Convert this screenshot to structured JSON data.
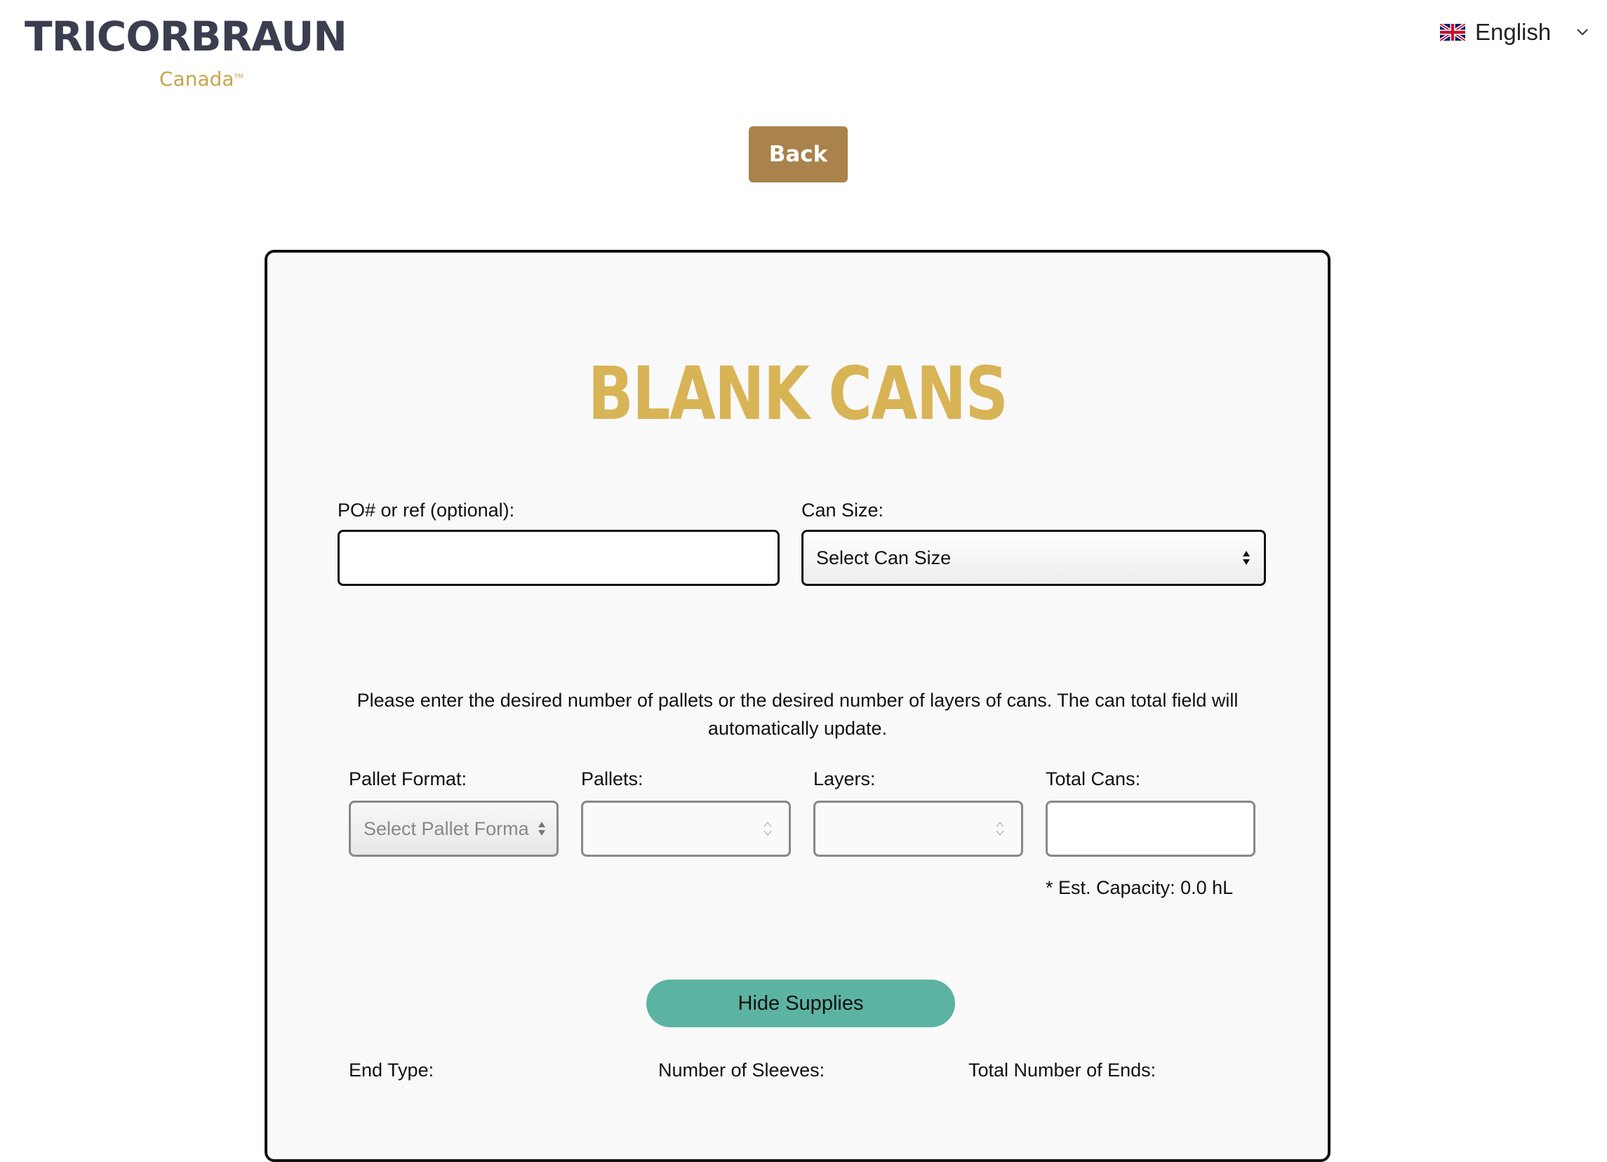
{
  "header": {
    "logo_main": "TRICORBRAUN",
    "logo_sub": "Canada",
    "logo_tm": "TM",
    "language": {
      "label": "English",
      "flag_icon": "uk-flag-icon",
      "chevron_icon": "chevron-down-icon"
    }
  },
  "back_button": {
    "label": "Back",
    "color": "#a9834b"
  },
  "form": {
    "title": "BLANK CANS",
    "title_color": "#d8b456",
    "po_label": "PO# or ref (optional):",
    "po_value": "",
    "can_size_label": "Can Size:",
    "can_size_value": "Select Can Size",
    "instructions": "Please enter the desired number of pallets or the desired number of layers of cans. The can total field will automatically update.",
    "pallet_format_label": "Pallet Format:",
    "pallet_format_value": "Select Pallet Forma",
    "pallets_label": "Pallets:",
    "layers_label": "Layers:",
    "total_cans_label": "Total Cans:",
    "capacity_text": "* Est. Capacity: 0.0 hL",
    "hide_supplies_label": "Hide Supplies",
    "hide_supplies_color": "#5db3a2",
    "end_type_label": "End Type:",
    "sleeves_label": "Number of Sleeves:",
    "total_ends_label": "Total Number of Ends:"
  }
}
